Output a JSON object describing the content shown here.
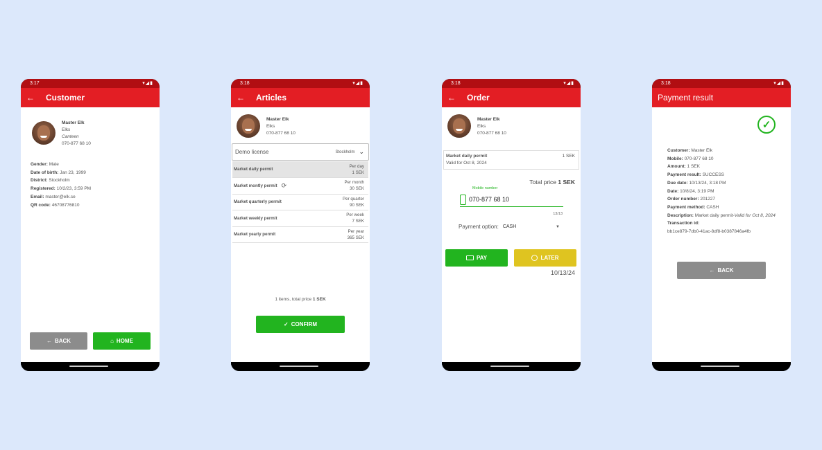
{
  "colors": {
    "primary": "#e31e24",
    "statusbar": "#b10e12",
    "green": "#22b41f",
    "yellow": "#dfc420",
    "grey": "#8c8c8c"
  },
  "customer_screen": {
    "time": "3:17",
    "title": "Customer",
    "customer": {
      "name": "Master Elk",
      "org": "Elks",
      "unit": "Canteen",
      "phone": "070-877 68 10"
    },
    "details": [
      {
        "label": "Gender:",
        "value": "Male"
      },
      {
        "label": "Date of birth:",
        "value": "Jan 23, 1999"
      },
      {
        "label": "District:",
        "value": "Stockholm"
      },
      {
        "label": "Registered:",
        "value": "10/2/23, 3:59 PM"
      },
      {
        "label": "Email:",
        "value": "master@elk.se"
      },
      {
        "label": "QR code:",
        "value": "46708776810"
      }
    ],
    "back_label": "BACK",
    "home_label": "HOME"
  },
  "articles_screen": {
    "time": "3:18",
    "title": "Articles",
    "customer": {
      "name": "Master Elk",
      "org": "Elks",
      "phone": "070-877 68 10"
    },
    "license": {
      "name": "Demo license",
      "district": "Stockholm"
    },
    "items": [
      {
        "name": "Market daily permit",
        "period": "Per day",
        "price": "1 SEK"
      },
      {
        "name": "Market montly permit",
        "period": "Per month",
        "price": "30 SEK"
      },
      {
        "name": "Market quarterly permit",
        "period": "Per quarter",
        "price": "90 SEK"
      },
      {
        "name": "Market weekly permit",
        "period": "Per week",
        "price": "7 SEK"
      },
      {
        "name": "Market yearly permit",
        "period": "Per year",
        "price": "365 SEK"
      }
    ],
    "summary_prefix": "1 items, total price",
    "summary_total": "1 SEK",
    "confirm_label": "CONFIRM"
  },
  "order_screen": {
    "time": "3:18",
    "title": "Order",
    "customer": {
      "name": "Master Elk",
      "org": "Elks",
      "phone": "070-877 68 10"
    },
    "item": {
      "name": "Market daily permit",
      "valid": "Valid for Oct 8, 2024",
      "price": "1 SEK"
    },
    "total_label": "Total price",
    "total_value": "1 SEK",
    "mobile_label": "Mobile number",
    "mobile_value": "070-877 68 10",
    "mobile_counter": "13/13",
    "payment_label": "Payment option:",
    "payment_value": "CASH",
    "pay_label": "PAY",
    "later_label": "LATER",
    "date": "10/13/24"
  },
  "result_screen": {
    "time": "3:18",
    "title": "Payment result",
    "fields": [
      {
        "label": "Customer:",
        "value": "Master Elk",
        "italic": ""
      },
      {
        "label": "Mobile:",
        "value": "070-877 68 10",
        "italic": ""
      },
      {
        "label": "Amount:",
        "value": "1 SEK",
        "italic": ""
      },
      {
        "label": "Payment result:",
        "value": "SUCCESS",
        "italic": ""
      },
      {
        "label": "Due date:",
        "value": "10/13/24, 3:18 PM",
        "italic": ""
      },
      {
        "label": "Date:",
        "value": "10/8/24, 3:19 PM",
        "italic": ""
      },
      {
        "label": "Order number:",
        "value": "201227",
        "italic": ""
      },
      {
        "label": "Payment method:",
        "value": "CASH",
        "italic": ""
      },
      {
        "label": "Description:",
        "value": "Market daily permit",
        "italic": "-Valid for Oct 8, 2024"
      },
      {
        "label": "Transaction id:",
        "value": "",
        "italic": ""
      }
    ],
    "transaction_id": "bb1ce879-7db0-41ac-8df8-b0387846a4fb",
    "back_label": "BACK"
  }
}
